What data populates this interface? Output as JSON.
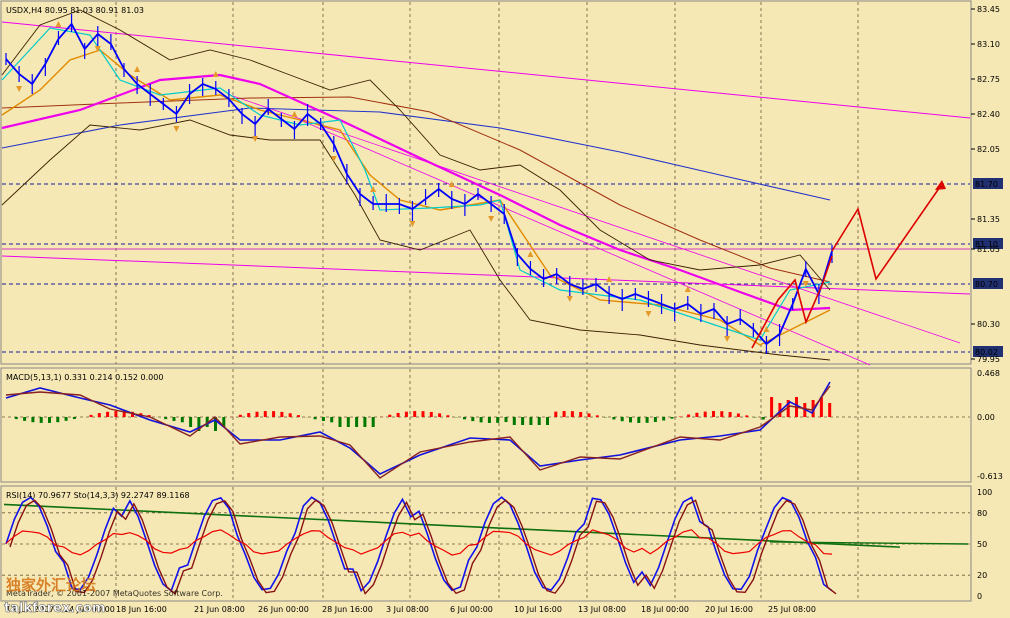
{
  "chart_data": {
    "type": "line",
    "symbol_header": "USDX,H4  80.95 81.03 80.91 81.03",
    "price_scale": {
      "ticks": [
        "83.45",
        "83.10",
        "82.75",
        "82.40",
        "82.05",
        "81.70",
        "81.35",
        "81.10",
        "81.05",
        "80.70",
        "80.30",
        "80.02",
        "79.95"
      ],
      "boxed": [
        "81.70",
        "81.10",
        "80.70",
        "80.02"
      ],
      "ylim": [
        79.95,
        83.45
      ]
    },
    "horizontal_levels": [
      81.7,
      81.1,
      80.7,
      80.02
    ],
    "x_labels": [
      "14 Jun 2007",
      "14 Jun 00:00",
      "18 Jun 16:00",
      "21 Jun 08:00",
      "26 Jun 00:00",
      "28 Jun 16:00",
      "3 Jul 08:00",
      "6 Jul 00:00",
      "10 Jul 16:00",
      "13 Jul 08:00",
      "18 Jul 00:00",
      "20 Jul 16:00",
      "25 Jul 08:00"
    ],
    "close_series": [
      82.95,
      82.8,
      82.7,
      82.9,
      83.15,
      83.3,
      83.05,
      83.2,
      83.1,
      82.85,
      82.7,
      82.6,
      82.5,
      82.4,
      82.6,
      82.7,
      82.65,
      82.55,
      82.4,
      82.3,
      82.45,
      82.35,
      82.25,
      82.4,
      82.3,
      82.1,
      81.8,
      81.6,
      81.5,
      81.5,
      81.5,
      81.45,
      81.55,
      81.65,
      81.55,
      81.5,
      81.6,
      81.5,
      81.4,
      81.0,
      80.85,
      80.75,
      80.8,
      80.7,
      80.65,
      80.7,
      80.6,
      80.55,
      80.6,
      80.55,
      80.5,
      80.45,
      80.5,
      80.4,
      80.45,
      80.3,
      80.35,
      80.25,
      80.1,
      80.2,
      80.5,
      80.85,
      80.6,
      81.03
    ],
    "forecast_path": [
      81.03,
      81.45,
      80.75,
      81.7
    ],
    "macd": {
      "header": "MACD(5,13,1) 0.331 0.214 0.152 0.000",
      "ticks": [
        "0.468",
        "0.00",
        "-0.613"
      ],
      "ylim": [
        -0.613,
        0.468
      ]
    },
    "rsi_stoch": {
      "header": "RSI(14) 70.9677  Sto(14,3,3) 92.2747 89.1168",
      "ticks": [
        "100",
        "80",
        "50",
        "20",
        "0"
      ],
      "ylim": [
        0,
        100
      ]
    }
  },
  "watermark": {
    "cn": "独家外汇论坛",
    "site": "talkforex.com",
    "copyright": "MetaTrader, © 2001-2007 MetaQuotes Software Corp."
  },
  "colors": {
    "background": "#f6e8b4",
    "price": "#0000ff",
    "ma_magenta": "#ee00ee",
    "ma_blue": "#2233cc",
    "bands": "#3a2000",
    "ma_brown": "#a03010",
    "macd_up": "#ff0000",
    "macd_down": "#007700",
    "forecast": "#dd0000",
    "trend_green": "#107010",
    "fractal": "#e39a2a"
  }
}
